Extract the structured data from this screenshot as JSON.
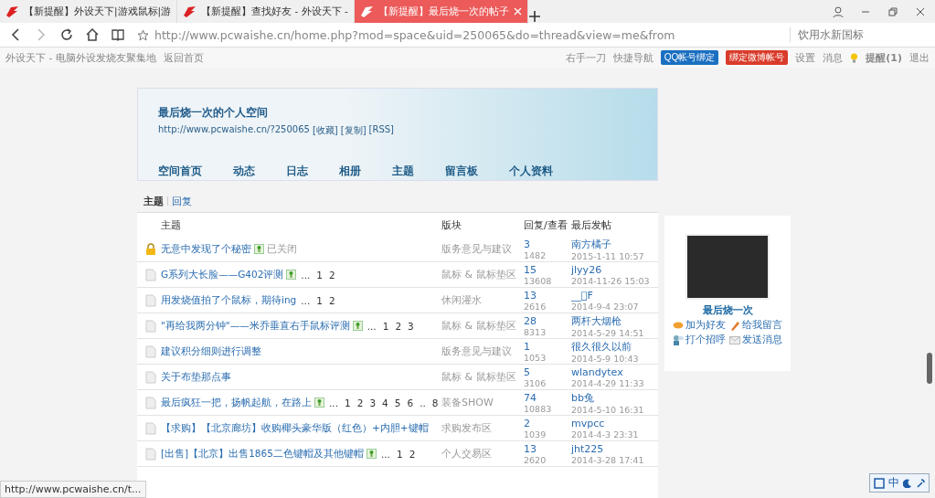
{
  "browser": {
    "tabs": [
      {
        "title": "【新提醒】外设天下|游戏鼠标|游",
        "selected": false
      },
      {
        "title": "【新提醒】查找好友 - 外设天下 -",
        "selected": false
      },
      {
        "title": "【新提醒】最后烧一次的帖子",
        "selected": true
      }
    ],
    "url": "http://www.pcwaishe.cn/home.php?mod=space&uid=250065&do=thread&view=me&from",
    "search": {
      "placeholder": "饮用水新国标"
    }
  },
  "topnav": {
    "site": "外设天下 - 电脑外设发烧友聚集地",
    "home": "返回首页",
    "user": "右手一刀",
    "quick": "快捷导航",
    "qq": "QQ帐号绑定",
    "weibo": "绑定微博帐号",
    "links": [
      "设置",
      "消息"
    ],
    "remind": "提醒(1)",
    "logout": "退出"
  },
  "space": {
    "title": "最后烧一次的个人空间",
    "url": "http://www.pcwaishe.cn/?250065",
    "url_links": [
      "[收藏]",
      "[复制]",
      "[RSS]"
    ],
    "nav": [
      "空间首页",
      "动态",
      "日志",
      "相册",
      "主题",
      "留言板",
      "个人资料"
    ]
  },
  "threads": {
    "tabs": [
      {
        "label": "主题",
        "selected": true
      },
      {
        "label": "回复",
        "selected": false
      }
    ],
    "columns": [
      "主题",
      "版块",
      "回复/查看",
      "最后发帖"
    ],
    "rows": [
      {
        "kind": "locked",
        "title": "无意中发现了个秘密",
        "image": true,
        "status": "已关闭",
        "pages": [],
        "forum": "版务意见与建议",
        "replies": "3",
        "views": "1482",
        "last_user": "南方橘子",
        "last_time": "2015-1-11 10:57"
      },
      {
        "kind": "normal",
        "title": "G系列大长脸——G402评测",
        "image": true,
        "pages": [
          "...",
          "1",
          "2"
        ],
        "forum": "鼠标 & 鼠标垫区",
        "replies": "15",
        "views": "13608",
        "last_user": "jlyy26",
        "last_time": "2014-11-26 15:03"
      },
      {
        "kind": "normal",
        "title": "用发烧值拍了个鼠标，期待ing",
        "image": false,
        "pages": [
          "...",
          "1",
          "2"
        ],
        "forum": "休闲灌水",
        "replies": "13",
        "views": "2616",
        "last_user": "__ﾟF",
        "last_time": "2014-9-4 23:07"
      },
      {
        "kind": "normal",
        "title": "\"再给我两分钟\"——米乔垂直右手鼠标评测",
        "image": true,
        "pages": [
          "...",
          "1",
          "2",
          "3"
        ],
        "forum": "鼠标 & 鼠标垫区",
        "replies": "28",
        "views": "8313",
        "last_user": "两杆大烟枪",
        "last_time": "2014-5-29 14:51"
      },
      {
        "kind": "normal",
        "title": "建议积分细则进行调整",
        "image": false,
        "pages": [],
        "forum": "版务意见与建议",
        "replies": "1",
        "views": "1053",
        "last_user": "很久很久以前",
        "last_time": "2014-5-9 10:43"
      },
      {
        "kind": "normal",
        "title": "关于布垫那点事",
        "image": false,
        "pages": [],
        "forum": "鼠标 & 鼠标垫区",
        "replies": "5",
        "views": "3106",
        "last_user": "wlandytex",
        "last_time": "2014-4-29 11:33"
      },
      {
        "kind": "normal",
        "title": "最后疯狂一把，扬帆起航，在路上",
        "image": true,
        "pages": [
          "...",
          "1",
          "2",
          "3",
          "4",
          "5",
          "6",
          "..",
          "8"
        ],
        "forum": "装备SHOW",
        "replies": "74",
        "views": "10883",
        "last_user": "bb兔",
        "last_time": "2014-5-10 16:31"
      },
      {
        "kind": "normal",
        "title": "【求购】【北京廊坊】收购椰头豪华版（红色）+内胆+键帽",
        "image": false,
        "pages": [],
        "forum": "求购发布区",
        "replies": "2",
        "views": "1039",
        "last_user": "mvpcc",
        "last_time": "2014-4-3 23:31"
      },
      {
        "kind": "normal",
        "title": "[出售]【北京】出售1865二色键帽及其他键帽",
        "image": true,
        "pages": [
          "...",
          "1",
          "2"
        ],
        "forum": "个人交易区",
        "replies": "13",
        "views": "2620",
        "last_user": "jht225",
        "last_time": "2014-3-28 17:41"
      }
    ]
  },
  "profile": {
    "name": "最后烧一次",
    "actions": [
      {
        "kind": "friend",
        "label": "加为好友"
      },
      {
        "kind": "comment",
        "label": "给我留言"
      },
      {
        "kind": "greet",
        "label": "打个招呼"
      },
      {
        "kind": "message",
        "label": "发送消息"
      }
    ]
  },
  "status_url": "http://www.pcwaishe.cn/t...",
  "ime": {
    "mode": "中"
  }
}
